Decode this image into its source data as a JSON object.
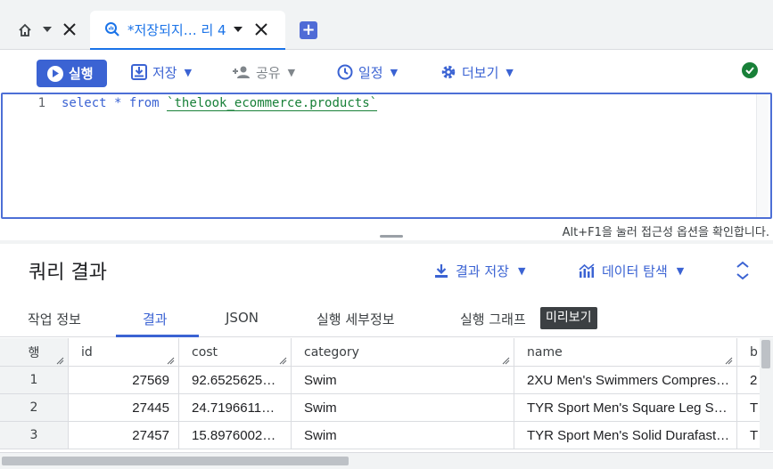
{
  "tabs": {
    "query_tab_title": "*저장되지… 리 4"
  },
  "toolbar": {
    "run_label": "실행",
    "save_label": "저장",
    "share_label": "공유",
    "schedule_label": "일정",
    "more_label": "더보기"
  },
  "editor": {
    "line_number": "1",
    "kw_select": "select",
    "star": "*",
    "kw_from": "from",
    "table_ref": "`thelook_ecommerce.products`",
    "a11y_hint": "Alt+F1을 눌러 접근성 옵션을 확인합니다."
  },
  "results": {
    "title": "쿼리 결과",
    "save_results_label": "결과 저장",
    "explore_data_label": "데이터 탐색",
    "tabs": [
      "작업 정보",
      "결과",
      "JSON",
      "실행 세부정보",
      "실행 그래프"
    ],
    "preview_badge": "미리보기",
    "columns": [
      "행",
      "id",
      "cost",
      "category",
      "name",
      "b"
    ],
    "rows": [
      {
        "row": "1",
        "id": "27569",
        "cost": "92.6525625…",
        "category": "Swim",
        "name": "2XU Men's Swimmers Compres…",
        "b": "2"
      },
      {
        "row": "2",
        "id": "27445",
        "cost": "24.7196611…",
        "category": "Swim",
        "name": "TYR Sport Men's Square Leg S…",
        "b": "T"
      },
      {
        "row": "3",
        "id": "27457",
        "cost": "15.8976002…",
        "category": "Swim",
        "name": "TYR Sport Men's Solid Durafast…",
        "b": "T"
      }
    ]
  },
  "colors": {
    "accent": "#3b63d3",
    "success": "#188038",
    "border": "#dadce0"
  }
}
